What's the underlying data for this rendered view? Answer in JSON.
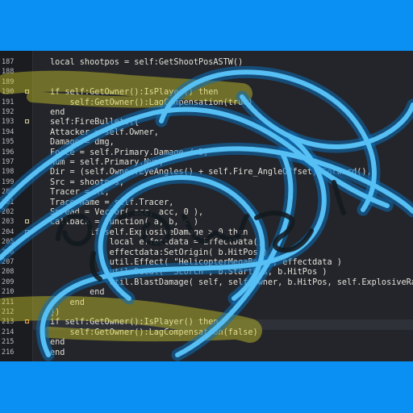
{
  "editor": {
    "lines": [
      {
        "num": "187",
        "text": "local shootpos = self:GetShootPosASTW()",
        "marker": ""
      },
      {
        "num": "188",
        "text": "",
        "marker": ""
      },
      {
        "num": "189",
        "text": "",
        "marker": ""
      },
      {
        "num": "190",
        "text": "if self:GetOwner():IsPlayer() then",
        "marker": "fold"
      },
      {
        "num": "191",
        "text": "    self:GetOwner():LagCompensation(true)",
        "marker": ""
      },
      {
        "num": "192",
        "text": "end",
        "marker": ""
      },
      {
        "num": "193",
        "text": "self:FireBullets({",
        "marker": "fold"
      },
      {
        "num": "194",
        "text": "Attacker = self.Owner,",
        "marker": ""
      },
      {
        "num": "195",
        "text": "Damage = dmg,",
        "marker": ""
      },
      {
        "num": "196",
        "text": "Force = self.Primary.Damage / 3,",
        "marker": ""
      },
      {
        "num": "197",
        "text": "Num = self.Primary.Num,",
        "marker": ""
      },
      {
        "num": "198",
        "text": "Dir = (self.Owner:EyeAngles() + self.Fire_AngleOffset):Forward(),",
        "marker": ""
      },
      {
        "num": "199",
        "text": "Src = shootpos,",
        "marker": ""
      },
      {
        "num": "200",
        "text": "Tracer = nt,",
        "marker": ""
      },
      {
        "num": "201",
        "text": "TracerName = self.Tracer,",
        "marker": ""
      },
      {
        "num": "202",
        "text": "Spread = Vector( acc, acc, 0 ),",
        "marker": ""
      },
      {
        "num": "203",
        "text": "Callback = function( a, b, c )",
        "marker": "fold"
      },
      {
        "num": "204",
        "text": "        if self.ExplosiveDamage > 0 then",
        "marker": "fold"
      },
      {
        "num": "205",
        "text": "            local effectdata = EffectData()",
        "marker": ""
      },
      {
        "num": "206",
        "text": "            effectdata:SetOrigin( b.HitPos )",
        "marker": ""
      },
      {
        "num": "207",
        "text": "            util.Effect( \"HelicopterMegaBomb\", effectdata )",
        "marker": ""
      },
      {
        "num": "208",
        "text": "            util.Decal( \"Scorch\", b.StartPos, b.HitPos )",
        "marker": ""
      },
      {
        "num": "209",
        "text": "            util.BlastDamage( self, self.Owner, b.HitPos, self.ExplosiveRadius, self.Exp",
        "marker": ""
      },
      {
        "num": "210",
        "text": "        end",
        "marker": ""
      },
      {
        "num": "211",
        "text": "    end",
        "marker": ""
      },
      {
        "num": "212",
        "text": "})",
        "marker": ""
      },
      {
        "num": "213",
        "text": "if self:GetOwner():IsPlayer() then",
        "marker": "mod"
      },
      {
        "num": "214",
        "text": "    self:GetOwner():LagCompensation(false)",
        "marker": ""
      },
      {
        "num": "215",
        "text": "end",
        "marker": ""
      },
      {
        "num": "216",
        "text": "end",
        "marker": ""
      }
    ]
  },
  "colors": {
    "background_blue": "#0a90f2",
    "editor_bg": "#23252a",
    "highlighter_yellow": "#d8d32a",
    "scribble_blue": "#49b6f0"
  },
  "icons": {
    "fold_marker": "square-fold-icon",
    "modified_marker": "square-modified-icon"
  }
}
